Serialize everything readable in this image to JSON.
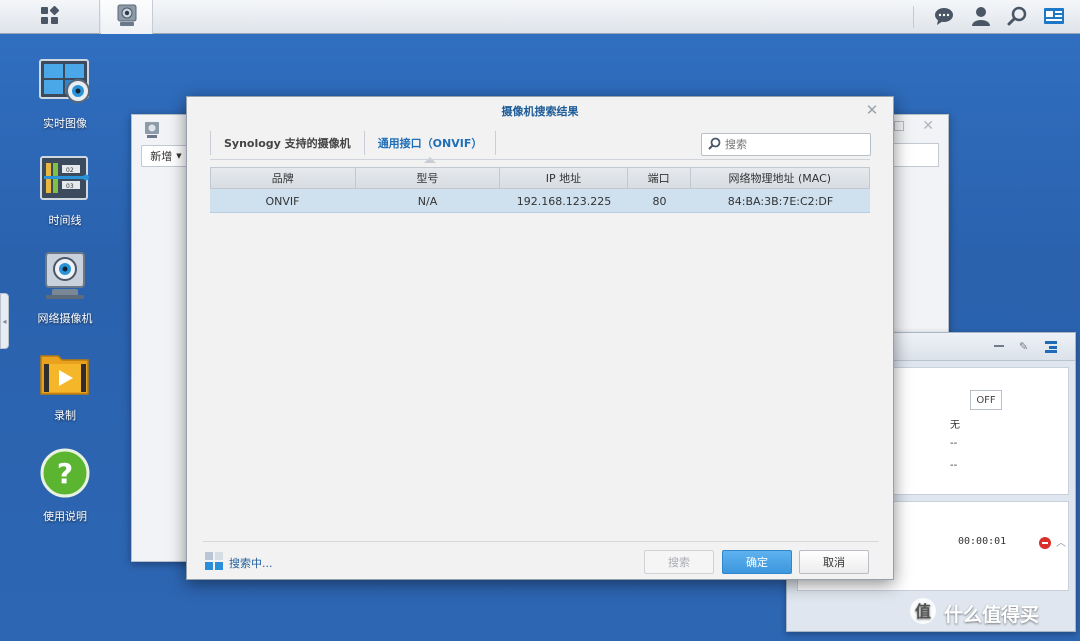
{
  "taskbar": {
    "main_menu_icon": "grid-icon",
    "active_app_icon": "surveillance-camera-icon",
    "right_icons": [
      "chat-icon",
      "user-icon",
      "search-icon",
      "widgets-icon"
    ]
  },
  "desktop": {
    "icons": [
      {
        "label": "实时图像",
        "icon": "live-view-icon"
      },
      {
        "label": "时间线",
        "icon": "timeline-icon"
      },
      {
        "label": "网络摄像机",
        "icon": "ip-camera-icon"
      },
      {
        "label": "录制",
        "icon": "recording-folder-icon"
      },
      {
        "label": "使用说明",
        "icon": "help-icon"
      }
    ]
  },
  "background_window": {
    "new_button": "新增"
  },
  "right_panel": {
    "off_label": "OFF",
    "text_fragment": "无",
    "dash1": "--",
    "dash2": "--",
    "timer": "00:00:01"
  },
  "dialog": {
    "title": "摄像机搜索结果",
    "tabs": [
      {
        "label": "Synology 支持的摄像机",
        "active": false
      },
      {
        "label": "通用接口（ONVIF）",
        "active": true
      }
    ],
    "search_placeholder": "搜索",
    "table": {
      "columns": [
        "品牌",
        "型号",
        "IP 地址",
        "端口",
        "网络物理地址 (MAC)"
      ],
      "rows": [
        {
          "brand": "ONVIF",
          "model": "N/A",
          "ip": "192.168.123.225",
          "port": "80",
          "mac": "84:BA:3B:7E:C2:DF"
        }
      ]
    },
    "status": "搜索中...",
    "buttons": {
      "search": "搜索",
      "ok": "确定",
      "cancel": "取消"
    }
  },
  "watermark": {
    "text": "什么值得买"
  },
  "colors": {
    "accent": "#1f6fb8",
    "desktop": "#2c64b0",
    "ok_button": "#3c97dd",
    "row_selected": "#cfe0ef"
  }
}
